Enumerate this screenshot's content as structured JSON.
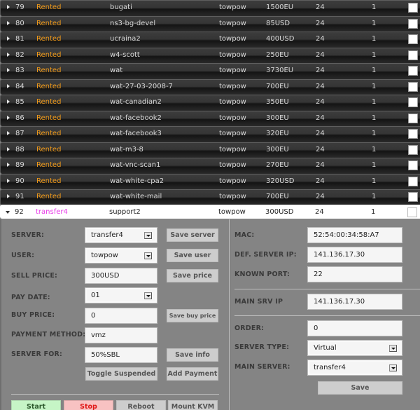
{
  "servers": [
    {
      "id": "79",
      "status": "Rented",
      "name": "bugati",
      "user": "towpow",
      "price": "1500EU",
      "hours": "24",
      "count": "1"
    },
    {
      "id": "80",
      "status": "Rented",
      "name": "ns3-bg-devel",
      "user": "towpow",
      "price": "85USD",
      "hours": "24",
      "count": "1"
    },
    {
      "id": "81",
      "status": "Rented",
      "name": "ucraina2",
      "user": "towpow",
      "price": "400USD",
      "hours": "24",
      "count": "1"
    },
    {
      "id": "82",
      "status": "Rented",
      "name": "w4-scott",
      "user": "towpow",
      "price": "250EU",
      "hours": "24",
      "count": "1"
    },
    {
      "id": "83",
      "status": "Rented",
      "name": "wat",
      "user": "towpow",
      "price": "3730EU",
      "hours": "24",
      "count": "1"
    },
    {
      "id": "84",
      "status": "Rented",
      "name": "wat-27-03-2008-7",
      "user": "towpow",
      "price": "700EU",
      "hours": "24",
      "count": "1"
    },
    {
      "id": "85",
      "status": "Rented",
      "name": "wat-canadian2",
      "user": "towpow",
      "price": "350EU",
      "hours": "24",
      "count": "1"
    },
    {
      "id": "86",
      "status": "Rented",
      "name": "wat-facebook2",
      "user": "towpow",
      "price": "300EU",
      "hours": "24",
      "count": "1"
    },
    {
      "id": "87",
      "status": "Rented",
      "name": "wat-facebook3",
      "user": "towpow",
      "price": "320EU",
      "hours": "24",
      "count": "1"
    },
    {
      "id": "88",
      "status": "Rented",
      "name": "wat-m3-8",
      "user": "towpow",
      "price": "300EU",
      "hours": "24",
      "count": "1"
    },
    {
      "id": "89",
      "status": "Rented",
      "name": "wat-vnc-scan1",
      "user": "towpow",
      "price": "270EU",
      "hours": "24",
      "count": "1"
    },
    {
      "id": "90",
      "status": "Rented",
      "name": "wat-white-cpa2",
      "user": "towpow",
      "price": "320USD",
      "hours": "24",
      "count": "1"
    },
    {
      "id": "91",
      "status": "Rented",
      "name": "wat-white-mail",
      "user": "towpow",
      "price": "700EU",
      "hours": "24",
      "count": "1"
    }
  ],
  "expanded": {
    "id": "92",
    "status": "transfer4",
    "name": "support2",
    "user": "towpow",
    "price": "300USD",
    "hours": "24",
    "count": "1"
  },
  "colors": {
    "rented": "#f09a1a",
    "transfer": "#e83ae8",
    "start_bg": "#c6f5c6",
    "stop_bg": "#f8c2c2",
    "stop_text": "#e01818"
  },
  "detail": {
    "left": {
      "server_label": "SERVER:",
      "server_value": "transfer4",
      "save_server": "Save server",
      "user_label": "USER:",
      "user_value": "towpow",
      "save_user": "Save user",
      "sell_price_label": "SELL PRICE:",
      "sell_price_value": "300USD",
      "save_price": "Save price",
      "pay_date_label": "PAY DATE:",
      "pay_date_value": "01",
      "buy_price_label": "BUY PRICE:",
      "buy_price_value": "0",
      "save_buy_price": "Save buy price",
      "payment_method_label": "PAYMENT METHOD:",
      "payment_method_value": "vmz",
      "server_for_label": "SERVER FOR:",
      "server_for_value": "50%SBL",
      "save_info": "Save info",
      "toggle_suspended": "Toggle Suspended",
      "add_payment": "Add Payment",
      "start": "Start",
      "stop": "Stop",
      "reboot": "Reboot",
      "mount_kvm": "Mount KVM"
    },
    "right": {
      "mac_label": "MAC:",
      "mac_value": "52:54:00:34:58:A7",
      "def_ip_label": "DEF. SERVER IP:",
      "def_ip_value": "141.136.17.30",
      "known_port_label": "KNOWN PORT:",
      "known_port_value": "22",
      "main_srv_ip_label": "MAIN SRV IP",
      "main_srv_ip_value": "141.136.17.30",
      "order_label": "ORDER:",
      "order_value": "0",
      "server_type_label": "SERVER TYPE:",
      "server_type_value": "Virtual",
      "main_server_label": "MAIN SERVER:",
      "main_server_value": "transfer4",
      "save": "Save"
    }
  }
}
